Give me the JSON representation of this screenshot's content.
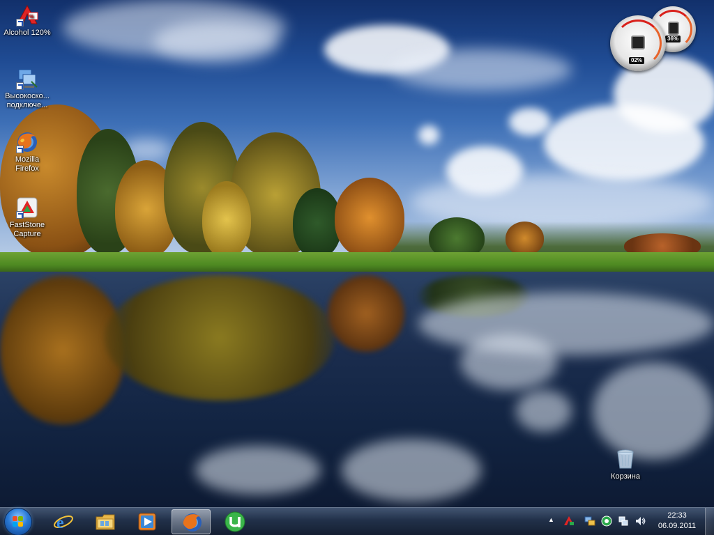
{
  "desktop": {
    "icons": [
      {
        "label": "Alcohol 120%",
        "label2": "",
        "icon": "alcohol-120-icon"
      },
      {
        "label": "Высокоско...",
        "label2": "подключе...",
        "icon": "network-connection-icon"
      },
      {
        "label": "Mozilla",
        "label2": "Firefox",
        "icon": "firefox-icon"
      },
      {
        "label": "FastStone",
        "label2": "Capture",
        "icon": "faststone-capture-icon"
      }
    ],
    "recycle_bin": {
      "label": "Корзина",
      "icon": "recycle-bin-icon"
    }
  },
  "gadget": {
    "cpu_percent": "02%",
    "memory_percent": "36%"
  },
  "taskbar": {
    "start_icon": "windows-start-icon",
    "pinned": [
      {
        "name": "internet-explorer",
        "icon": "internet-explorer-icon",
        "active": false
      },
      {
        "name": "windows-explorer",
        "icon": "folder-icon",
        "active": false
      },
      {
        "name": "media-player",
        "icon": "media-player-icon",
        "active": false
      },
      {
        "name": "firefox",
        "icon": "firefox-icon",
        "active": true
      },
      {
        "name": "utorrent",
        "icon": "utorrent-icon",
        "active": false
      }
    ],
    "tray": {
      "show_hidden": "▲",
      "icons": [
        "alcohol-tray-icon",
        "network-share-icon",
        "green-status-icon",
        "network-icon",
        "volume-icon"
      ]
    },
    "clock": {
      "time": "22:33",
      "date": "06.09.2011"
    }
  }
}
